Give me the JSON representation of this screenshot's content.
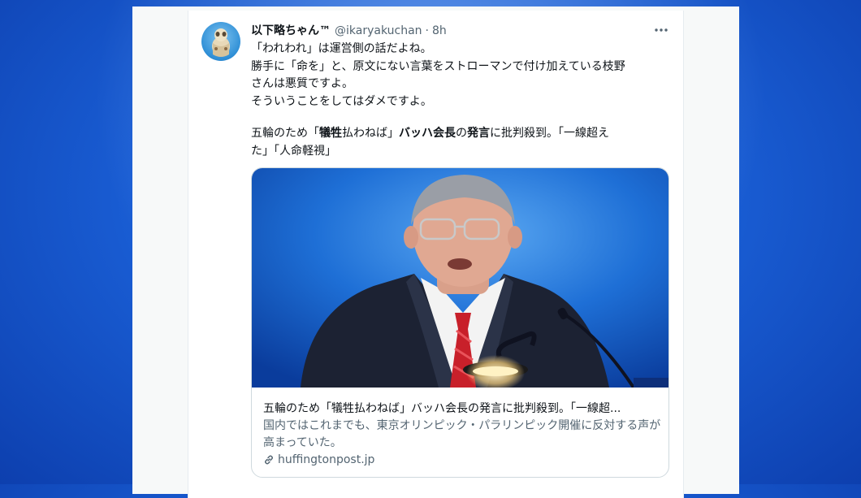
{
  "tweet": {
    "display_name": "以下略ちゃん™",
    "handle": "@ikaryakuchan",
    "separator": "·",
    "time": "8h",
    "lines": [
      "「われわれ」は運営側の話だよね。",
      "勝手に「命を」と、原文にない言葉をストローマンで付け加えている枝野",
      "さんは悪質ですよ。",
      "そういうことをしてはダメですよ。"
    ],
    "headline_parts": {
      "p1": "五輪のため「",
      "p2": "犠牲",
      "p3": "払わねば」",
      "p4": "バッハ会長",
      "p5": "の",
      "p6": "発言",
      "p7": "に批判殺到。「一線超え",
      "p8": "た」「人命軽視」"
    }
  },
  "link_card": {
    "title": "五輪のため「犠牲払わねば」バッハ会長の発言に批判殺到。「一線超...",
    "description": "国内ではこれまでも、東京オリンピック・パラリンピック開催に反対する声が高まっていた。",
    "domain": "huffingtonpost.jp"
  },
  "icons": {
    "more": "more-icon",
    "link": "link-icon"
  },
  "colors": {
    "background_blue": "#1a5fd6",
    "text_primary": "#0f1419",
    "text_secondary": "#536471",
    "card_border": "#cfd9de",
    "tie_red": "#c8202a"
  }
}
